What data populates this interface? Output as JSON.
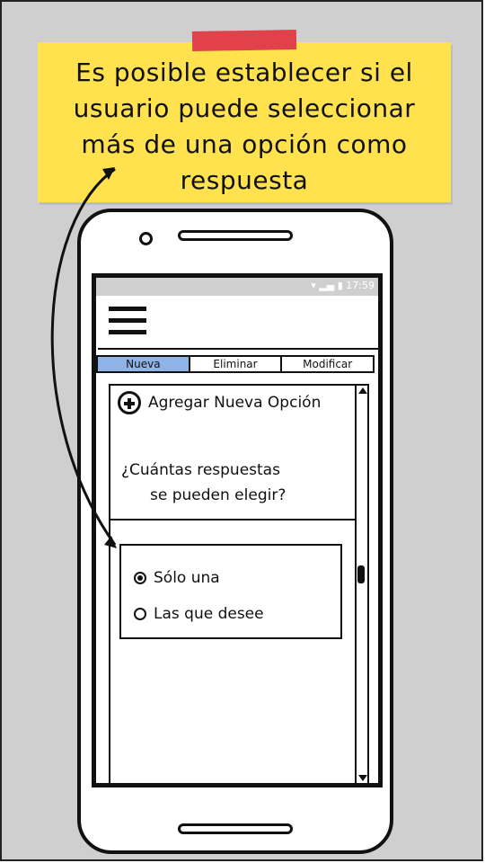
{
  "note": {
    "lines": [
      "Es posible establecer si el",
      "usuario puede seleccionar",
      "más de una opción como",
      "respuesta"
    ]
  },
  "status": {
    "time": "17:59"
  },
  "tabs": [
    "Nueva",
    "Eliminar",
    "Modificar"
  ],
  "add_option_label": "Agregar Nueva Opción",
  "question": {
    "line1": "¿Cuántas respuestas",
    "line2": "se pueden elegir?"
  },
  "options": [
    {
      "label": "Sólo una",
      "selected": true
    },
    {
      "label": "Las que desee",
      "selected": false
    }
  ],
  "colors": {
    "background": "#cfcfcf",
    "sticky_note": "#ffe24d",
    "tape": "#e0414a",
    "active_tab": "#8fb3e6"
  }
}
